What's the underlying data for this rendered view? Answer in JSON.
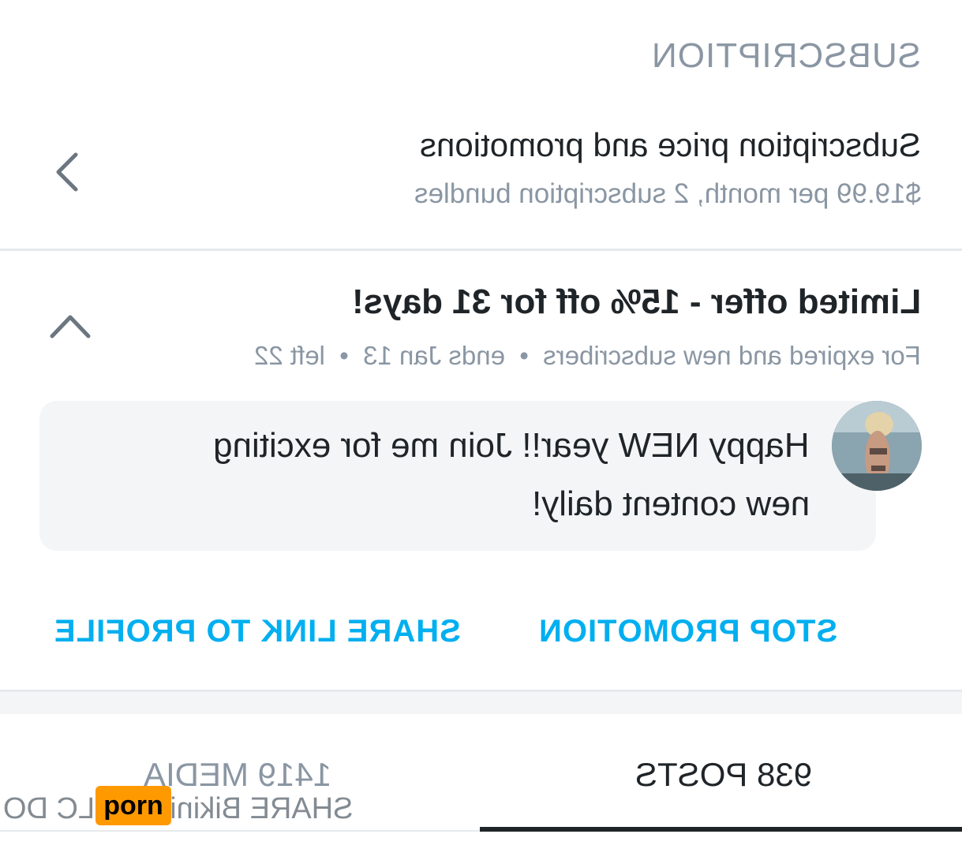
{
  "section": {
    "label": "SUBSCRIPTION"
  },
  "subscription": {
    "title": "Subscription price and promotions",
    "description": "$19.99 per month, 2 subscription bundles"
  },
  "offer": {
    "title": "Limited offer - 15% off for 31 days!",
    "meta": "For expired and new subscribers  •  ends Jan 13  •  left 22",
    "message_line1": "Happy NEW year!! Join me for exciting",
    "message_line2": "new content daily!"
  },
  "actions": {
    "stop_label": "STOP PROMOTION",
    "share_label": "SHARE LINK TO PROFILE"
  },
  "tabs": {
    "posts": "938 POSTS",
    "media": "1419 MEDIA"
  },
  "watermark": {
    "text": "SHARE Bikinibee LLC DO",
    "badge": "porn"
  },
  "colors": {
    "accent": "#00aff0",
    "muted": "#8a96a3",
    "text": "#1f2428"
  },
  "icons": {
    "back": "chevron-left-icon",
    "collapse": "chevron-up-icon"
  }
}
